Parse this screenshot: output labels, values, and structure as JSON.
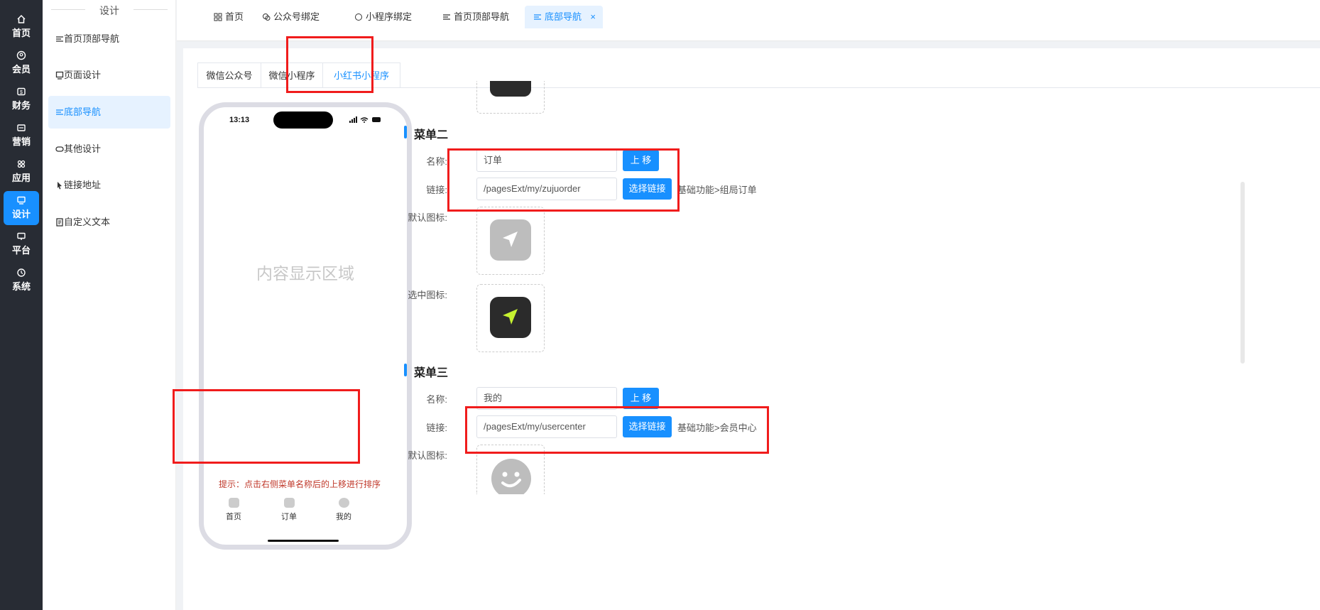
{
  "rail": [
    {
      "label": "首页",
      "icon": "home-icon"
    },
    {
      "label": "会员",
      "icon": "user-circle-icon"
    },
    {
      "label": "财务",
      "icon": "wallet-icon"
    },
    {
      "label": "营销",
      "icon": "ticket-icon"
    },
    {
      "label": "应用",
      "icon": "apps-icon"
    },
    {
      "label": "设计",
      "icon": "monitor-icon",
      "active": true
    },
    {
      "label": "平台",
      "icon": "desktop-icon"
    },
    {
      "label": "系统",
      "icon": "gear-icon"
    }
  ],
  "submenu": {
    "title": "设计",
    "items": [
      {
        "label": "首页顶部导航",
        "icon": "sliders-icon"
      },
      {
        "label": "页面设计",
        "icon": "monitor-icon"
      },
      {
        "label": "底部导航",
        "icon": "sliders-icon",
        "active": true
      },
      {
        "label": "其他设计",
        "icon": "gamepad-icon"
      },
      {
        "label": "链接地址",
        "icon": "cursor-icon"
      },
      {
        "label": "自定义文本",
        "icon": "document-icon"
      }
    ]
  },
  "tabs": [
    {
      "label": "首页",
      "icon": "grid-icon"
    },
    {
      "label": "公众号绑定",
      "icon": "wechat-icon"
    },
    {
      "label": "小程序绑定",
      "icon": "chat-icon"
    },
    {
      "label": "首页顶部导航",
      "icon": "sliders-icon"
    },
    {
      "label": "底部导航",
      "icon": "sliders-icon",
      "active": true,
      "close": "×"
    }
  ],
  "platform_tabs": [
    {
      "label": "微信公众号"
    },
    {
      "label": "微信小程序"
    },
    {
      "label": "小红书小程序",
      "active": true
    }
  ],
  "phone": {
    "time": "13:13",
    "content_placeholder": "内容显示区域",
    "hint": "提示：点击右侧菜单名称后的上移进行排序",
    "nav": [
      {
        "label": "首页"
      },
      {
        "label": "订单"
      },
      {
        "label": "我的"
      }
    ]
  },
  "menu2": {
    "title": "菜单二",
    "name_label": "名称:",
    "name_value": "订单",
    "move_up": "上 移",
    "link_label": "链接:",
    "link_value": "/pagesExt/my/zujuorder",
    "select_link": "选择链接",
    "link_desc": "基础功能>组局订单",
    "default_icon_label": "默认图标:",
    "selected_icon_label": "选中图标:"
  },
  "menu3": {
    "title": "菜单三",
    "name_label": "名称:",
    "name_value": "我的",
    "move_up": "上 移",
    "link_label": "链接:",
    "link_value": "/pagesExt/my/usercenter",
    "select_link": "选择链接",
    "link_desc": "基础功能>会员中心",
    "default_icon_label": "默认图标:"
  },
  "colors": {
    "primary": "#1890ff",
    "rail_bg": "#282c34",
    "highlight_red": "#f01c1c",
    "icon_dark": "#2b2b2b",
    "icon_gray": "#bdbdbd",
    "icon_lime": "#c6f230"
  }
}
